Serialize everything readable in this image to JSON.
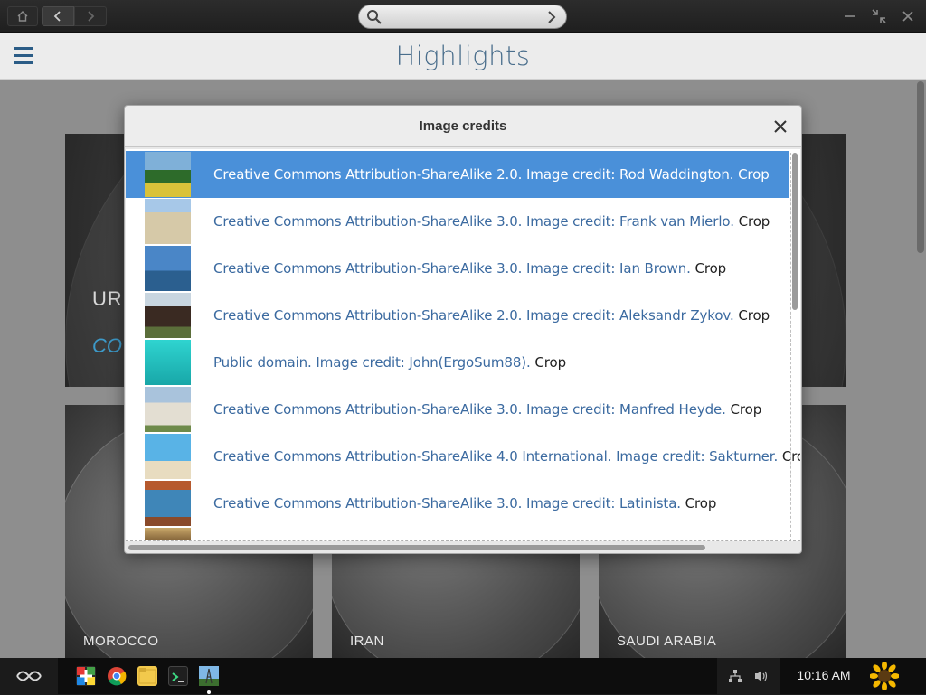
{
  "titlebar": {
    "search": {
      "placeholder": ""
    }
  },
  "header": {
    "title": "Highlights"
  },
  "background": {
    "featured_title": "UR",
    "featured_subtitle": "CO",
    "cards": [
      "MOROCCO",
      "IRAN",
      "SAUDI ARABIA"
    ]
  },
  "dialog": {
    "title": "Image credits",
    "items": [
      {
        "credit": "Creative Commons Attribution-ShareAlike 2.0. Image credit: Rod Waddington.",
        "crop": "Crop",
        "selected": true
      },
      {
        "credit": "Creative Commons Attribution-ShareAlike 3.0. Image credit: Frank van Mierlo.",
        "crop": "Crop",
        "selected": false
      },
      {
        "credit": "Creative Commons Attribution-ShareAlike 3.0. Image credit: Ian Brown.",
        "crop": "Crop",
        "selected": false
      },
      {
        "credit": "Creative Commons Attribution-ShareAlike 2.0. Image credit: Aleksandr Zykov.",
        "crop": "Crop",
        "selected": false
      },
      {
        "credit": "Public domain. Image credit: John(ErgoSum88).",
        "crop": "Crop",
        "selected": false
      },
      {
        "credit": "Creative Commons Attribution-ShareAlike 3.0. Image credit: Manfred Heyde.",
        "crop": "Crop",
        "selected": false
      },
      {
        "credit": "Creative Commons Attribution-ShareAlike 4.0 International. Image credit: Sakturner.",
        "crop": "Crop",
        "selected": false
      },
      {
        "credit": "Creative Commons Attribution-ShareAlike 3.0. Image credit: Latinista.",
        "crop": "Crop",
        "selected": false
      }
    ]
  },
  "taskbar": {
    "clock": "10:16 AM",
    "apps": [
      "app-store-icon",
      "chrome-icon",
      "files-icon",
      "terminal-icon",
      "encyclopedia-icon"
    ]
  },
  "colors": {
    "accent": "#4a90d9",
    "link": "#3b6aa0",
    "title": "#4a6e8c",
    "menu": "#2b5c86"
  }
}
